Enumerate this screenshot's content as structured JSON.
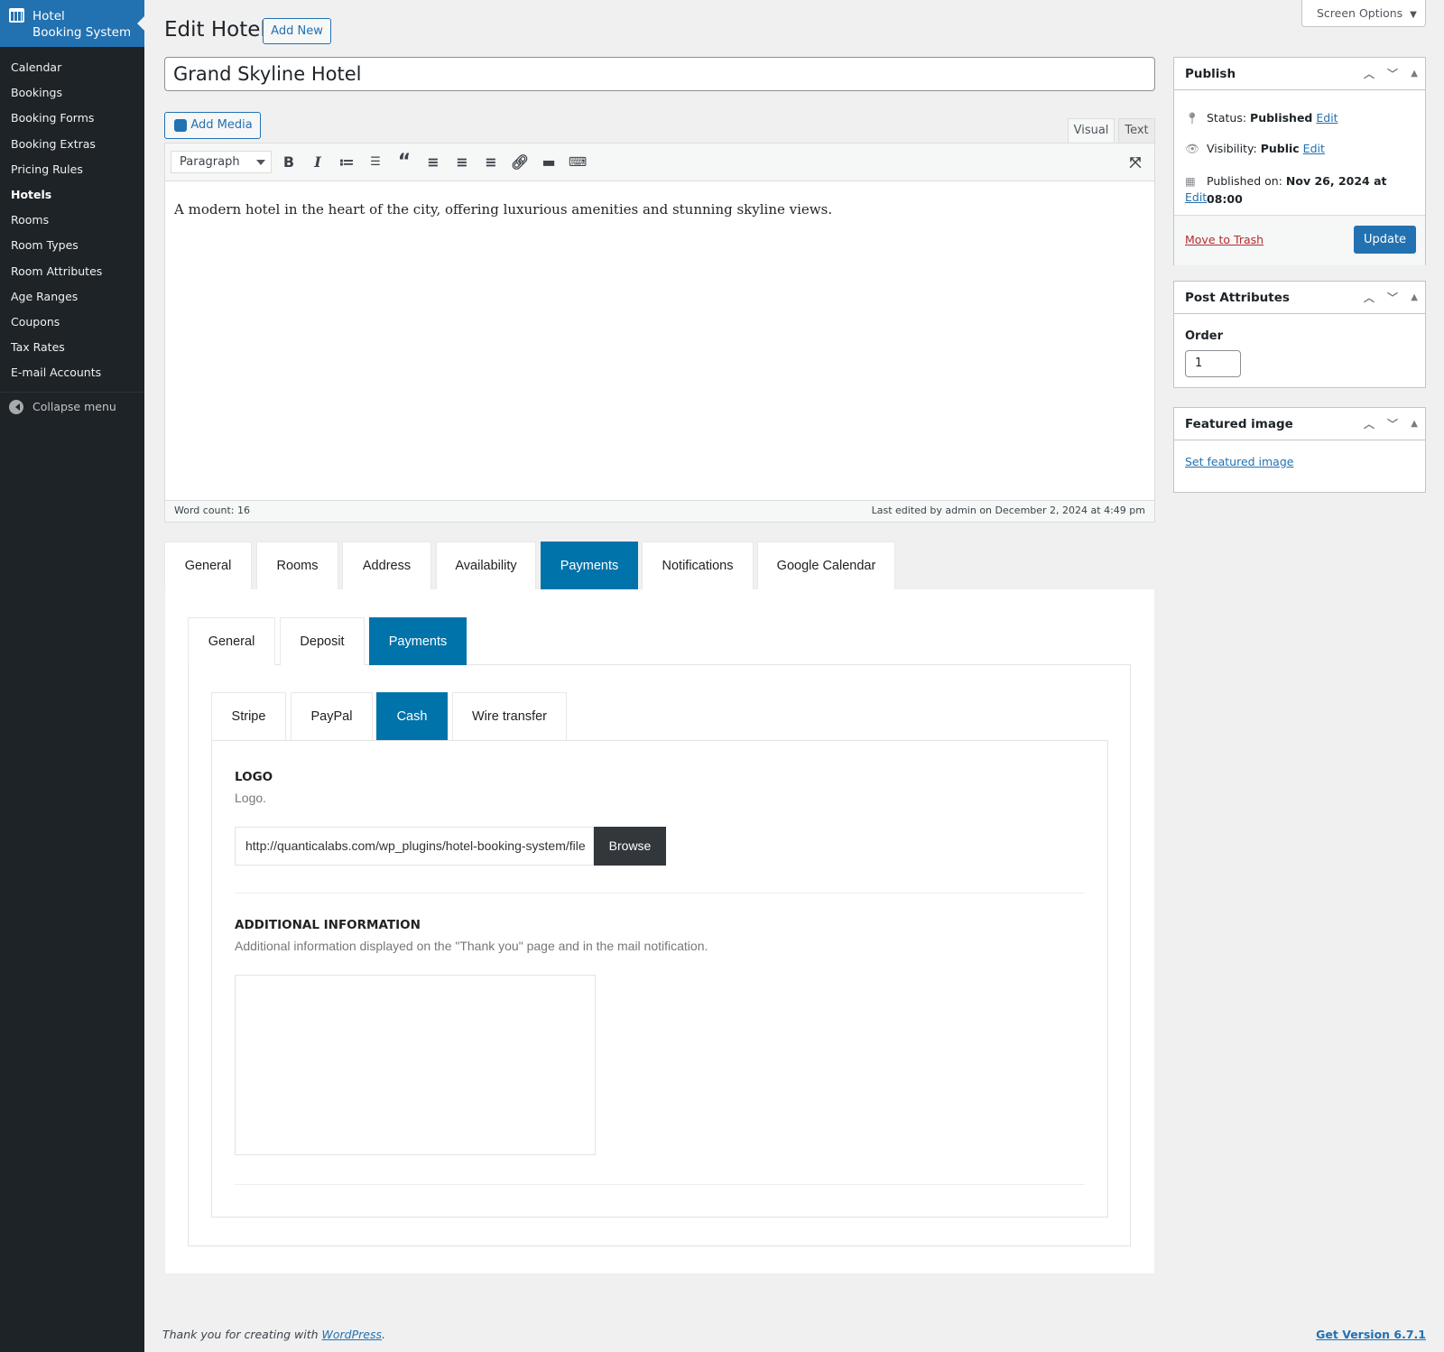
{
  "sidebar": {
    "brand_line1": "Hotel",
    "brand_line2": "Booking System",
    "items": [
      "Calendar",
      "Bookings",
      "Booking Forms",
      "Booking Extras",
      "Pricing Rules",
      "Hotels",
      "Rooms",
      "Room Types",
      "Room Attributes",
      "Age Ranges",
      "Coupons",
      "Tax Rates",
      "E-mail Accounts"
    ],
    "current": "Hotels",
    "collapse": "Collapse menu"
  },
  "header": {
    "title": "Edit Hotel",
    "add_new": "Add New",
    "screen_options": "Screen Options"
  },
  "post": {
    "title": "Grand Skyline Hotel",
    "add_media": "Add Media",
    "tab_visual": "Visual",
    "tab_text": "Text",
    "format": "Paragraph",
    "content": "A modern hotel in the heart of the city, offering luxurious amenities and stunning skyline views.",
    "word_count": "Word count: 16",
    "last_edited": "Last edited by admin on December 2, 2024 at 4:49 pm"
  },
  "tabs": {
    "main": [
      "General",
      "Rooms",
      "Address",
      "Availability",
      "Payments",
      "Notifications",
      "Google Calendar"
    ],
    "main_active": "Payments",
    "sub": [
      "General",
      "Deposit",
      "Payments"
    ],
    "sub_active": "Payments",
    "methods": [
      "Stripe",
      "PayPal",
      "Cash",
      "Wire transfer"
    ],
    "methods_active": "Cash"
  },
  "cash": {
    "logo_label": "LOGO",
    "logo_desc": "Logo.",
    "logo_url": "http://quanticalabs.com/wp_plugins/hotel-booking-system/file",
    "browse": "Browse",
    "info_label": "ADDITIONAL INFORMATION",
    "info_desc": "Additional information displayed on the \"Thank you\" page and in the mail notification.",
    "info_value": ""
  },
  "publish": {
    "title": "Publish",
    "status_label": "Status:",
    "status": "Published",
    "visibility_label": "Visibility:",
    "visibility": "Public",
    "published_label": "Published on:",
    "published": "Nov 26, 2024 at 08:00",
    "edit": "Edit",
    "trash": "Move to Trash",
    "update": "Update"
  },
  "attributes": {
    "title": "Post Attributes",
    "order_label": "Order",
    "order": "1"
  },
  "featured": {
    "title": "Featured image",
    "set": "Set featured image"
  },
  "footer": {
    "thanks": "Thank you for creating with ",
    "wp": "WordPress",
    "version": "Get Version 6.7.1"
  }
}
